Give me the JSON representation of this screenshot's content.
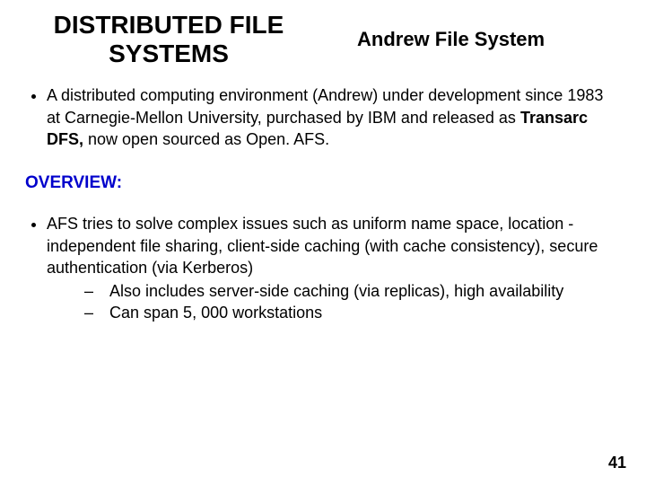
{
  "header": {
    "title_left_line1": "DISTRIBUTED FILE",
    "title_left_line2": "SYSTEMS",
    "title_right": "Andrew File System"
  },
  "bullet1": {
    "pre": "A distributed computing environment (Andrew) under development since 1983 at Carnegie-Mellon University, purchased by IBM and released as ",
    "bold": "Transarc DFS,",
    "post": " now open sourced as Open. AFS."
  },
  "overview_label": "OVERVIEW:",
  "bullet2": {
    "text": "AFS tries to solve complex issues such as uniform name space, location -independent file sharing, client-side caching (with cache consistency), secure authentication (via Kerberos)",
    "sub": [
      "Also includes server-side caching (via replicas), high availability",
      "Can span 5, 000 workstations"
    ]
  },
  "page_number": "41"
}
